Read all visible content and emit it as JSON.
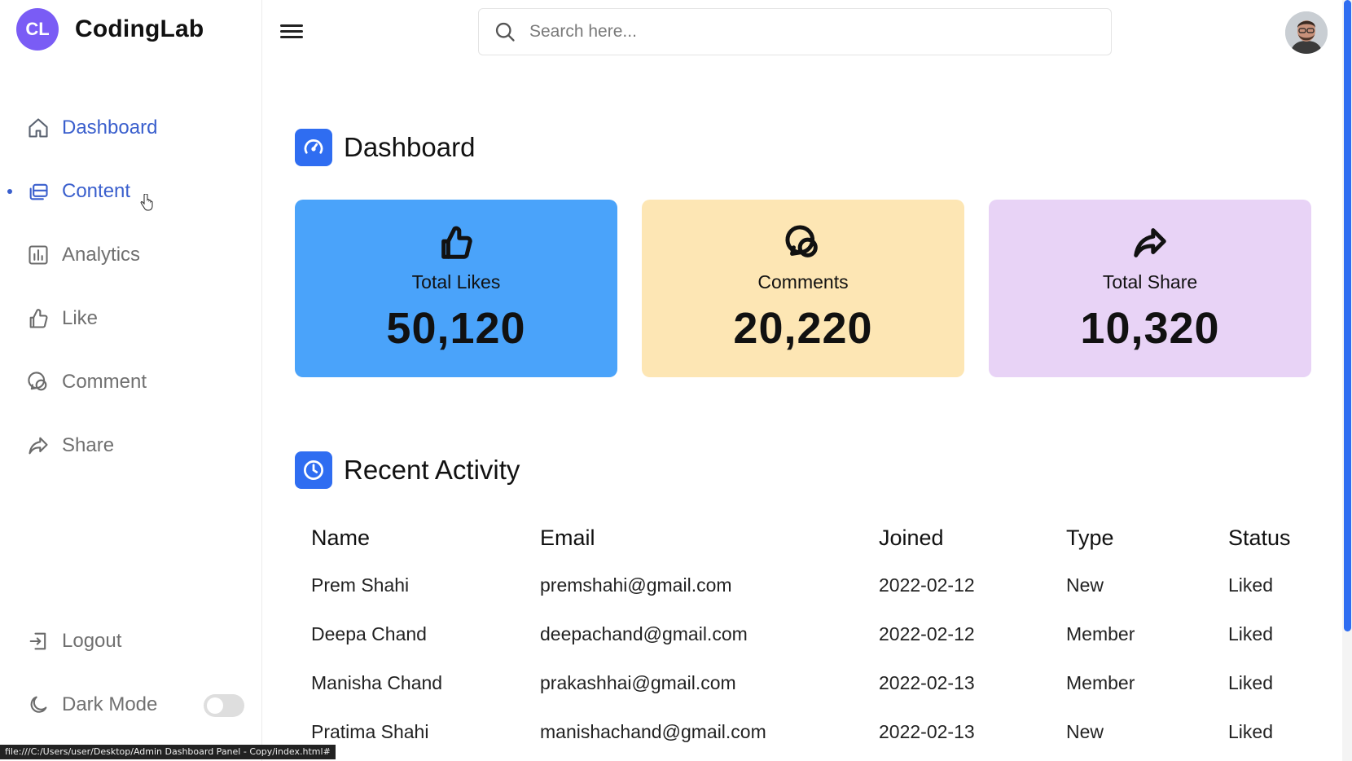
{
  "app": {
    "logo_initials": "CL",
    "name": "CodingLab",
    "accent": "#2f6df1",
    "logo_color": "#7a5cf5"
  },
  "sidebar": {
    "items": [
      {
        "label": "Dashboard",
        "icon": "home-icon"
      },
      {
        "label": "Content",
        "icon": "files-icon"
      },
      {
        "label": "Analytics",
        "icon": "bar-chart-icon"
      },
      {
        "label": "Like",
        "icon": "thumbs-up-icon"
      },
      {
        "label": "Comment",
        "icon": "comment-icon"
      },
      {
        "label": "Share",
        "icon": "share-icon"
      }
    ],
    "logout_label": "Logout",
    "dark_mode_label": "Dark Mode",
    "dark_mode_on": false
  },
  "topbar": {
    "search_placeholder": "Search here..."
  },
  "dashboard": {
    "title": "Dashboard",
    "cards": [
      {
        "label": "Total Likes",
        "value": "50,120",
        "color": "#4aa3fa",
        "icon": "thumbs-up-icon"
      },
      {
        "label": "Comments",
        "value": "20,220",
        "color": "#fde6b4",
        "icon": "comment-icon"
      },
      {
        "label": "Total Share",
        "value": "10,320",
        "color": "#e8d3f6",
        "icon": "share-icon"
      }
    ]
  },
  "activity": {
    "title": "Recent Activity",
    "columns": [
      "Name",
      "Email",
      "Joined",
      "Type",
      "Status"
    ],
    "rows": [
      [
        "Prem Shahi",
        "premshahi@gmail.com",
        "2022-02-12",
        "New",
        "Liked"
      ],
      [
        "Deepa Chand",
        "deepachand@gmail.com",
        "2022-02-12",
        "Member",
        "Liked"
      ],
      [
        "Manisha Chand",
        "prakashhai@gmail.com",
        "2022-02-13",
        "Member",
        "Liked"
      ],
      [
        "Pratima Shahi",
        "manishachand@gmail.com",
        "2022-02-13",
        "New",
        "Liked"
      ]
    ]
  },
  "statusbar": {
    "url": "file:///C:/Users/user/Desktop/Admin Dashboard Panel - Copy/index.html#"
  }
}
